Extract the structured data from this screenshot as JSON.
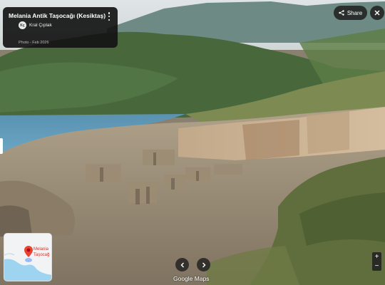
{
  "photo": {
    "title": "Melania Antik Taşocağı (Kesiktaş)",
    "author_initials": "Kç",
    "author_name": "Kral Çıplak",
    "date_text": "Photo - Feb 2026"
  },
  "share": {
    "label": "Share"
  },
  "minimap": {
    "place_label_line1": "Melania",
    "place_label_line2": "Taşocağ"
  },
  "watermark": "Google Maps",
  "icons": {
    "menu": "more-vert-icon",
    "share": "share-icon",
    "close": "close-icon",
    "prev": "chevron-left-icon",
    "next": "chevron-right-icon",
    "pin": "map-pin-icon"
  },
  "colors": {
    "pin": "#ea4335",
    "water": "#9fd4f0",
    "land": "#f1f3f4"
  }
}
